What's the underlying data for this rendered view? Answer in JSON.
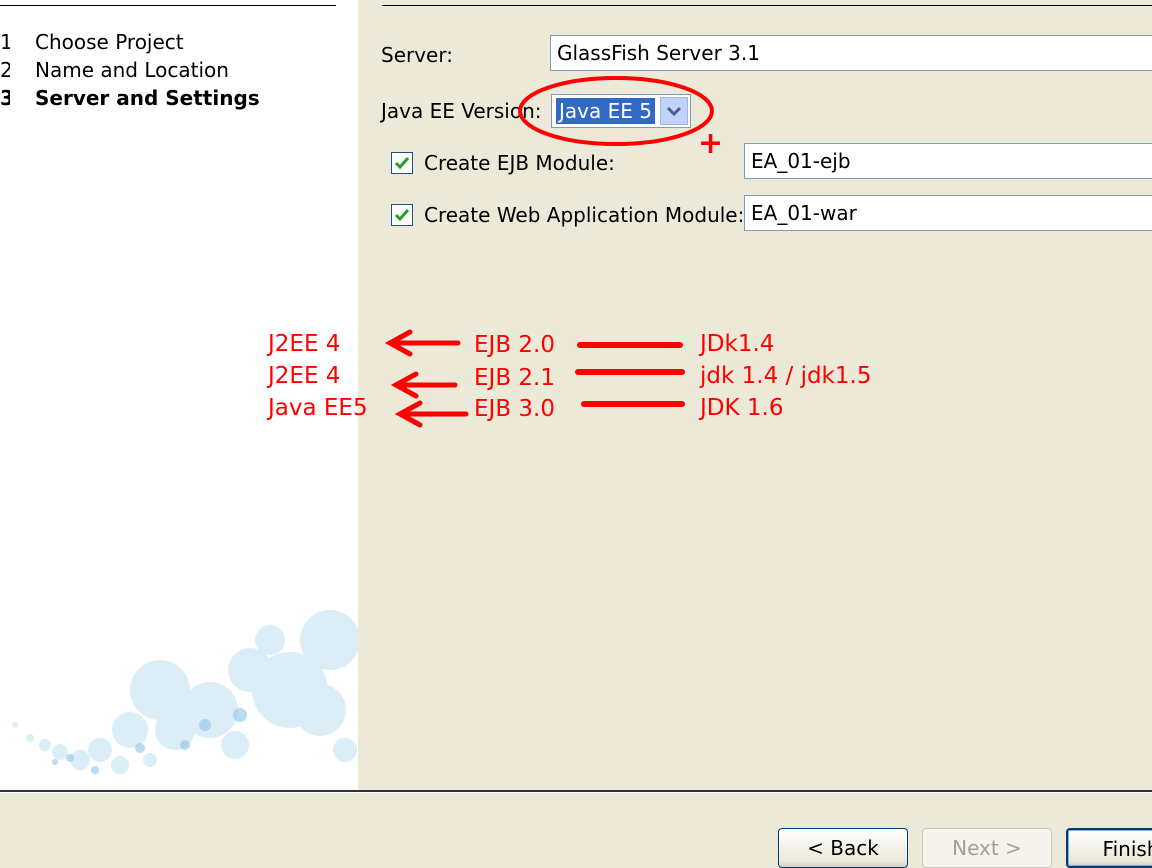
{
  "wizard": {
    "steps": [
      {
        "num": "1.",
        "label": "Choose Project",
        "current": false
      },
      {
        "num": "2.",
        "label": "Name and Location",
        "current": false
      },
      {
        "num": "3.",
        "label": "Server and Settings",
        "current": true
      }
    ]
  },
  "form": {
    "server_label": "Server:",
    "server_value": "GlassFish Server 3.1",
    "javaee_label": "Java EE Version:",
    "javaee_value": "Java EE 5",
    "ejb_checkbox_label": "Create EJB Module:",
    "ejb_checked": true,
    "ejb_value": "EA_01-ejb",
    "web_checkbox_label": "Create Web Application Module:",
    "web_checked": true,
    "web_value": "EA_01-war"
  },
  "annotations": {
    "plus_mark": "+",
    "rows": [
      {
        "left": "J2EE 4",
        "middle": "EJB 2.0",
        "right": "JDk1.4"
      },
      {
        "left": "J2EE 4",
        "middle": "EJB 2.1",
        "right": "jdk 1.4 / jdk1.5"
      },
      {
        "left": "Java EE5",
        "middle": "EJB 3.0",
        "right": "JDK 1.6"
      }
    ],
    "color": "#ff0000"
  },
  "buttons": {
    "back": "< Back",
    "next": "Next >",
    "finish": "Finish"
  },
  "colors": {
    "dialog_bg": "#ece9d8",
    "selection": "#316ac5",
    "check": "#21a121"
  }
}
